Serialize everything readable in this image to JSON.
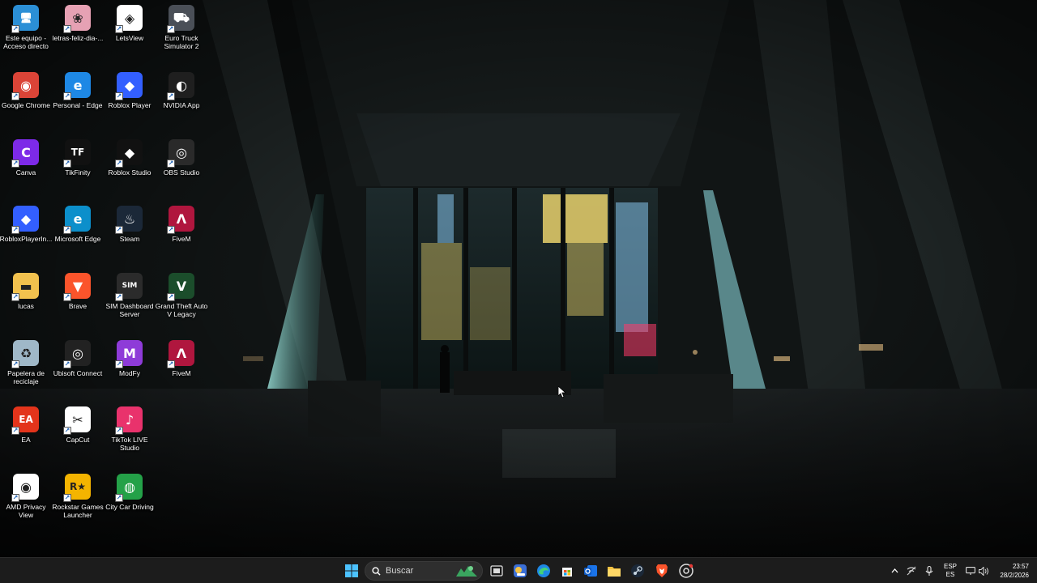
{
  "desktop": {
    "icons": [
      {
        "label": "Este equipo - Acceso directo",
        "glyph": "🖥",
        "icon": "this-pc-icon",
        "color": "#2b8fd6"
      },
      {
        "label": "letras-feliz-dia-...",
        "glyph": "❀",
        "icon": "image-file-icon",
        "color": "#e6a1b4"
      },
      {
        "label": "LetsView",
        "glyph": "◈",
        "icon": "letsview-icon",
        "color": "#ffffff"
      },
      {
        "label": "Euro Truck Simulator 2",
        "glyph": "⛟",
        "icon": "euro-truck-icon",
        "color": "#4a4f57"
      },
      {
        "label": "Google Chrome",
        "glyph": "◉",
        "icon": "chrome-icon",
        "color": "#db4437"
      },
      {
        "label": "Personal - Edge",
        "glyph": "e",
        "icon": "edge-icon",
        "color": "#1e88e5"
      },
      {
        "label": "Roblox Player",
        "glyph": "◆",
        "icon": "roblox-icon",
        "color": "#335fff"
      },
      {
        "label": "NVIDIA App",
        "glyph": "◐",
        "icon": "nvidia-icon",
        "color": "#1f1f1f"
      },
      {
        "label": "Canva",
        "glyph": "C",
        "icon": "canva-icon",
        "color": "#7d2ae8"
      },
      {
        "label": "TikFinity",
        "glyph": "TF",
        "icon": "tikfinity-icon",
        "color": "#111111"
      },
      {
        "label": "Roblox Studio",
        "glyph": "◆",
        "icon": "roblox-studio-icon",
        "color": "#111111"
      },
      {
        "label": "OBS Studio",
        "glyph": "◎",
        "icon": "obs-icon",
        "color": "#2a2a2a"
      },
      {
        "label": "RobloxPlayerIn...",
        "glyph": "◆",
        "icon": "roblox-installer-icon",
        "color": "#335fff"
      },
      {
        "label": "Microsoft Edge",
        "glyph": "e",
        "icon": "edge-icon",
        "color": "#0c8fcb"
      },
      {
        "label": "Steam",
        "glyph": "♨",
        "icon": "steam-icon",
        "color": "#1b2838"
      },
      {
        "label": "FiveM",
        "glyph": "Λ",
        "icon": "fivem-icon",
        "color": "#b0163e"
      },
      {
        "label": "lucas",
        "glyph": "▬",
        "icon": "folder-icon",
        "color": "#f2c14e"
      },
      {
        "label": "Brave",
        "glyph": "▼",
        "icon": "brave-icon",
        "color": "#fb542b"
      },
      {
        "label": "SIM Dashboard Server",
        "glyph": "SIM",
        "icon": "sim-dashboard-icon",
        "color": "#2b2b2b"
      },
      {
        "label": "Grand Theft Auto V Legacy",
        "glyph": "V",
        "icon": "gta-v-icon",
        "color": "#1b4d2b"
      },
      {
        "label": "Papelera de reciclaje",
        "glyph": "♻",
        "icon": "recycle-bin-icon",
        "color": "#9fb8c8"
      },
      {
        "label": "Ubisoft Connect",
        "glyph": "◎",
        "icon": "ubisoft-icon",
        "color": "#222222"
      },
      {
        "label": "ModFy",
        "glyph": "M",
        "icon": "modfy-icon",
        "color": "#8e3bd8"
      },
      {
        "label": "FiveM",
        "glyph": "Λ",
        "icon": "fivem-icon",
        "color": "#b0163e"
      },
      {
        "label": "EA",
        "glyph": "EA",
        "icon": "ea-icon",
        "color": "#e3341b"
      },
      {
        "label": "CapCut",
        "glyph": "✂",
        "icon": "capcut-icon",
        "color": "#ffffff"
      },
      {
        "label": "TikTok LIVE Studio",
        "glyph": "♪",
        "icon": "tiktok-live-icon",
        "color": "#e9326c"
      },
      {
        "label": "",
        "glyph": "",
        "icon": "",
        "color": ""
      },
      {
        "label": "AMD Privacy View",
        "glyph": "◉",
        "icon": "amd-privacy-icon",
        "color": "#ffffff"
      },
      {
        "label": "Rockstar Games Launcher",
        "glyph": "R★",
        "icon": "rockstar-icon",
        "color": "#f4b400"
      },
      {
        "label": "City Car Driving",
        "glyph": "◍",
        "icon": "city-car-driving-icon",
        "color": "#24a148"
      }
    ]
  },
  "taskbar": {
    "search_placeholder": "Buscar",
    "pinned": [
      {
        "icon": "file-explorer-icon",
        "color": "#f5c242"
      },
      {
        "icon": "steam-icon",
        "color": "#c7d5e0"
      },
      {
        "icon": "brave-icon",
        "color": "#fb542b"
      },
      {
        "icon": "chrome-icon",
        "color": "#db4437"
      }
    ],
    "tray": {
      "lang_top": "ESP",
      "lang_bottom": "ES",
      "time": "23:57",
      "date": "28/2/2026"
    }
  }
}
